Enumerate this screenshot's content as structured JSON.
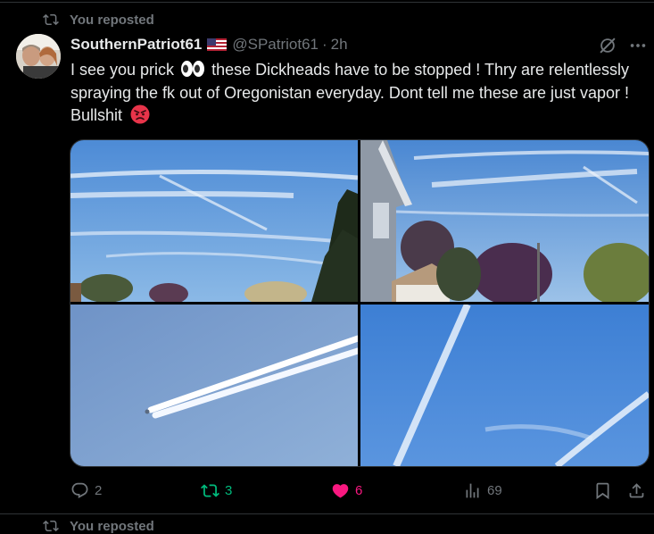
{
  "repost_banner": {
    "label": "You reposted"
  },
  "next_repost_banner": {
    "label": "You reposted"
  },
  "post": {
    "author_name": "SouthernPatriot61",
    "handle": "@SPatriot61",
    "separator": "·",
    "time": "2h",
    "text_part1": "I see you prick",
    "text_part2": " these Dickheads have to be stopped ! Thry are relentlessly spraying the fk out of Oregonistan everyday. Dont tell me these are just vapor ! Bullshit",
    "media": [
      {
        "name": "sky-contrails-tree-photo"
      },
      {
        "name": "house-contrails-photo"
      },
      {
        "name": "plane-contrail-closeup-photo"
      },
      {
        "name": "crossing-contrails-photo"
      }
    ]
  },
  "actions": {
    "replies": "2",
    "reposts": "3",
    "likes": "6",
    "views": "69"
  },
  "colors": {
    "background": "#000000",
    "text": "#e7e9ea",
    "muted": "#71767b",
    "repost_active": "#00ba7c",
    "like_active": "#f91880"
  },
  "icons": {
    "repost_banner": "repost-icon",
    "reply": "reply-icon",
    "repost": "repost-icon",
    "like": "heart-icon",
    "views": "analytics-icon",
    "bookmark": "bookmark-icon",
    "share": "share-icon",
    "grok": "grok-icon",
    "more": "more-icon"
  }
}
